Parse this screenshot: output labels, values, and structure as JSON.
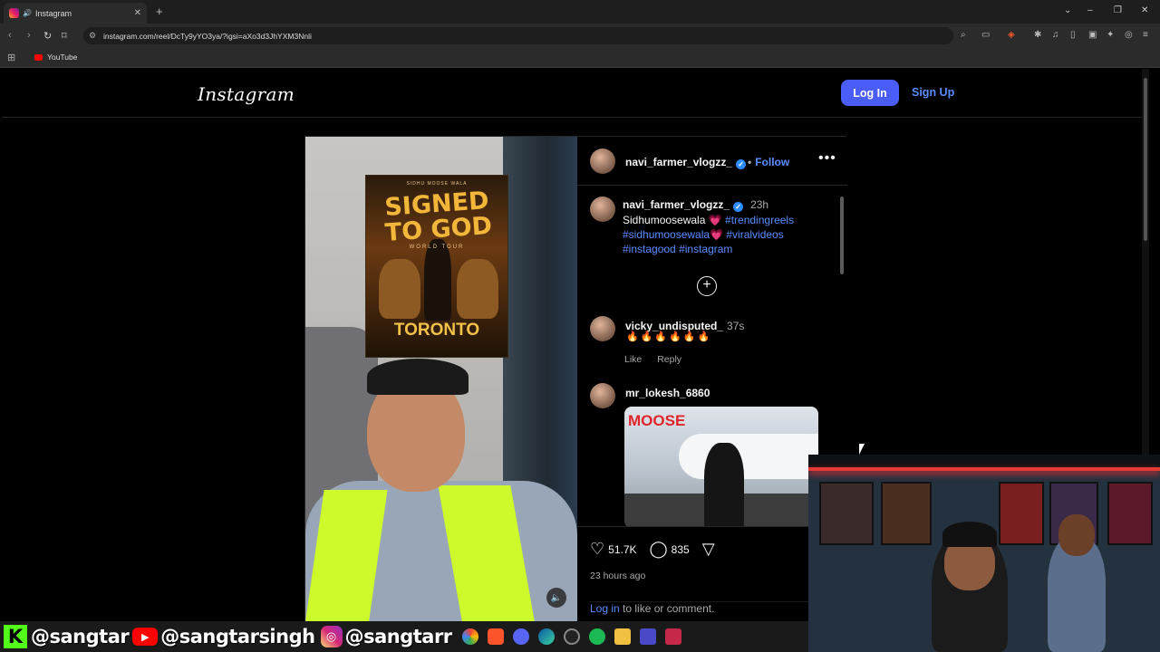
{
  "browser": {
    "tab_title": "Instagram",
    "url": "instagram.com/reel/DcTy9yYO3ya/?igsi=aXo3d3JhYXM3Nnli",
    "bookmark_youtube": "YouTube",
    "new_tab": "+"
  },
  "header": {
    "logo": "Instagram",
    "login_label": "Log In",
    "signup_label": "Sign Up"
  },
  "reel": {
    "poster_top": "SIDHU MOOSE WALA",
    "poster_title": "SIGNED TO GOD",
    "poster_world": "WORLD TOUR",
    "poster_city": "TORONTO"
  },
  "post": {
    "username": "navi_farmer_vlogzz_",
    "follow_label": "Follow",
    "caption_user": "navi_farmer_vlogzz_",
    "caption_time": "23h",
    "caption_text": "Sidhumoosewala",
    "caption_tags": [
      "#trendingreels",
      "#sidhumoosewala",
      "#viralvideos",
      "#instagood",
      "#instagram"
    ],
    "comments": [
      {
        "user": "vicky_undisputed_",
        "time": "37s",
        "text": "🔥🔥🔥🔥🔥🔥",
        "like": "Like",
        "reply": "Reply"
      },
      {
        "user": "mr_lokesh_6860",
        "image_title": "MOOSE"
      }
    ],
    "likes": "51.7K",
    "comments_count": "835",
    "posted": "23 hours ago",
    "login_link": "Log in",
    "login_suffix": " to like or comment."
  },
  "overlay": {
    "kick_handle": "@sangtar",
    "youtube_handle": "@sangtarsingh",
    "instagram_handle": "@sangtarr"
  },
  "colors": {
    "accent": "#4a5df9",
    "link": "#5b8cff",
    "background": "#000000"
  }
}
